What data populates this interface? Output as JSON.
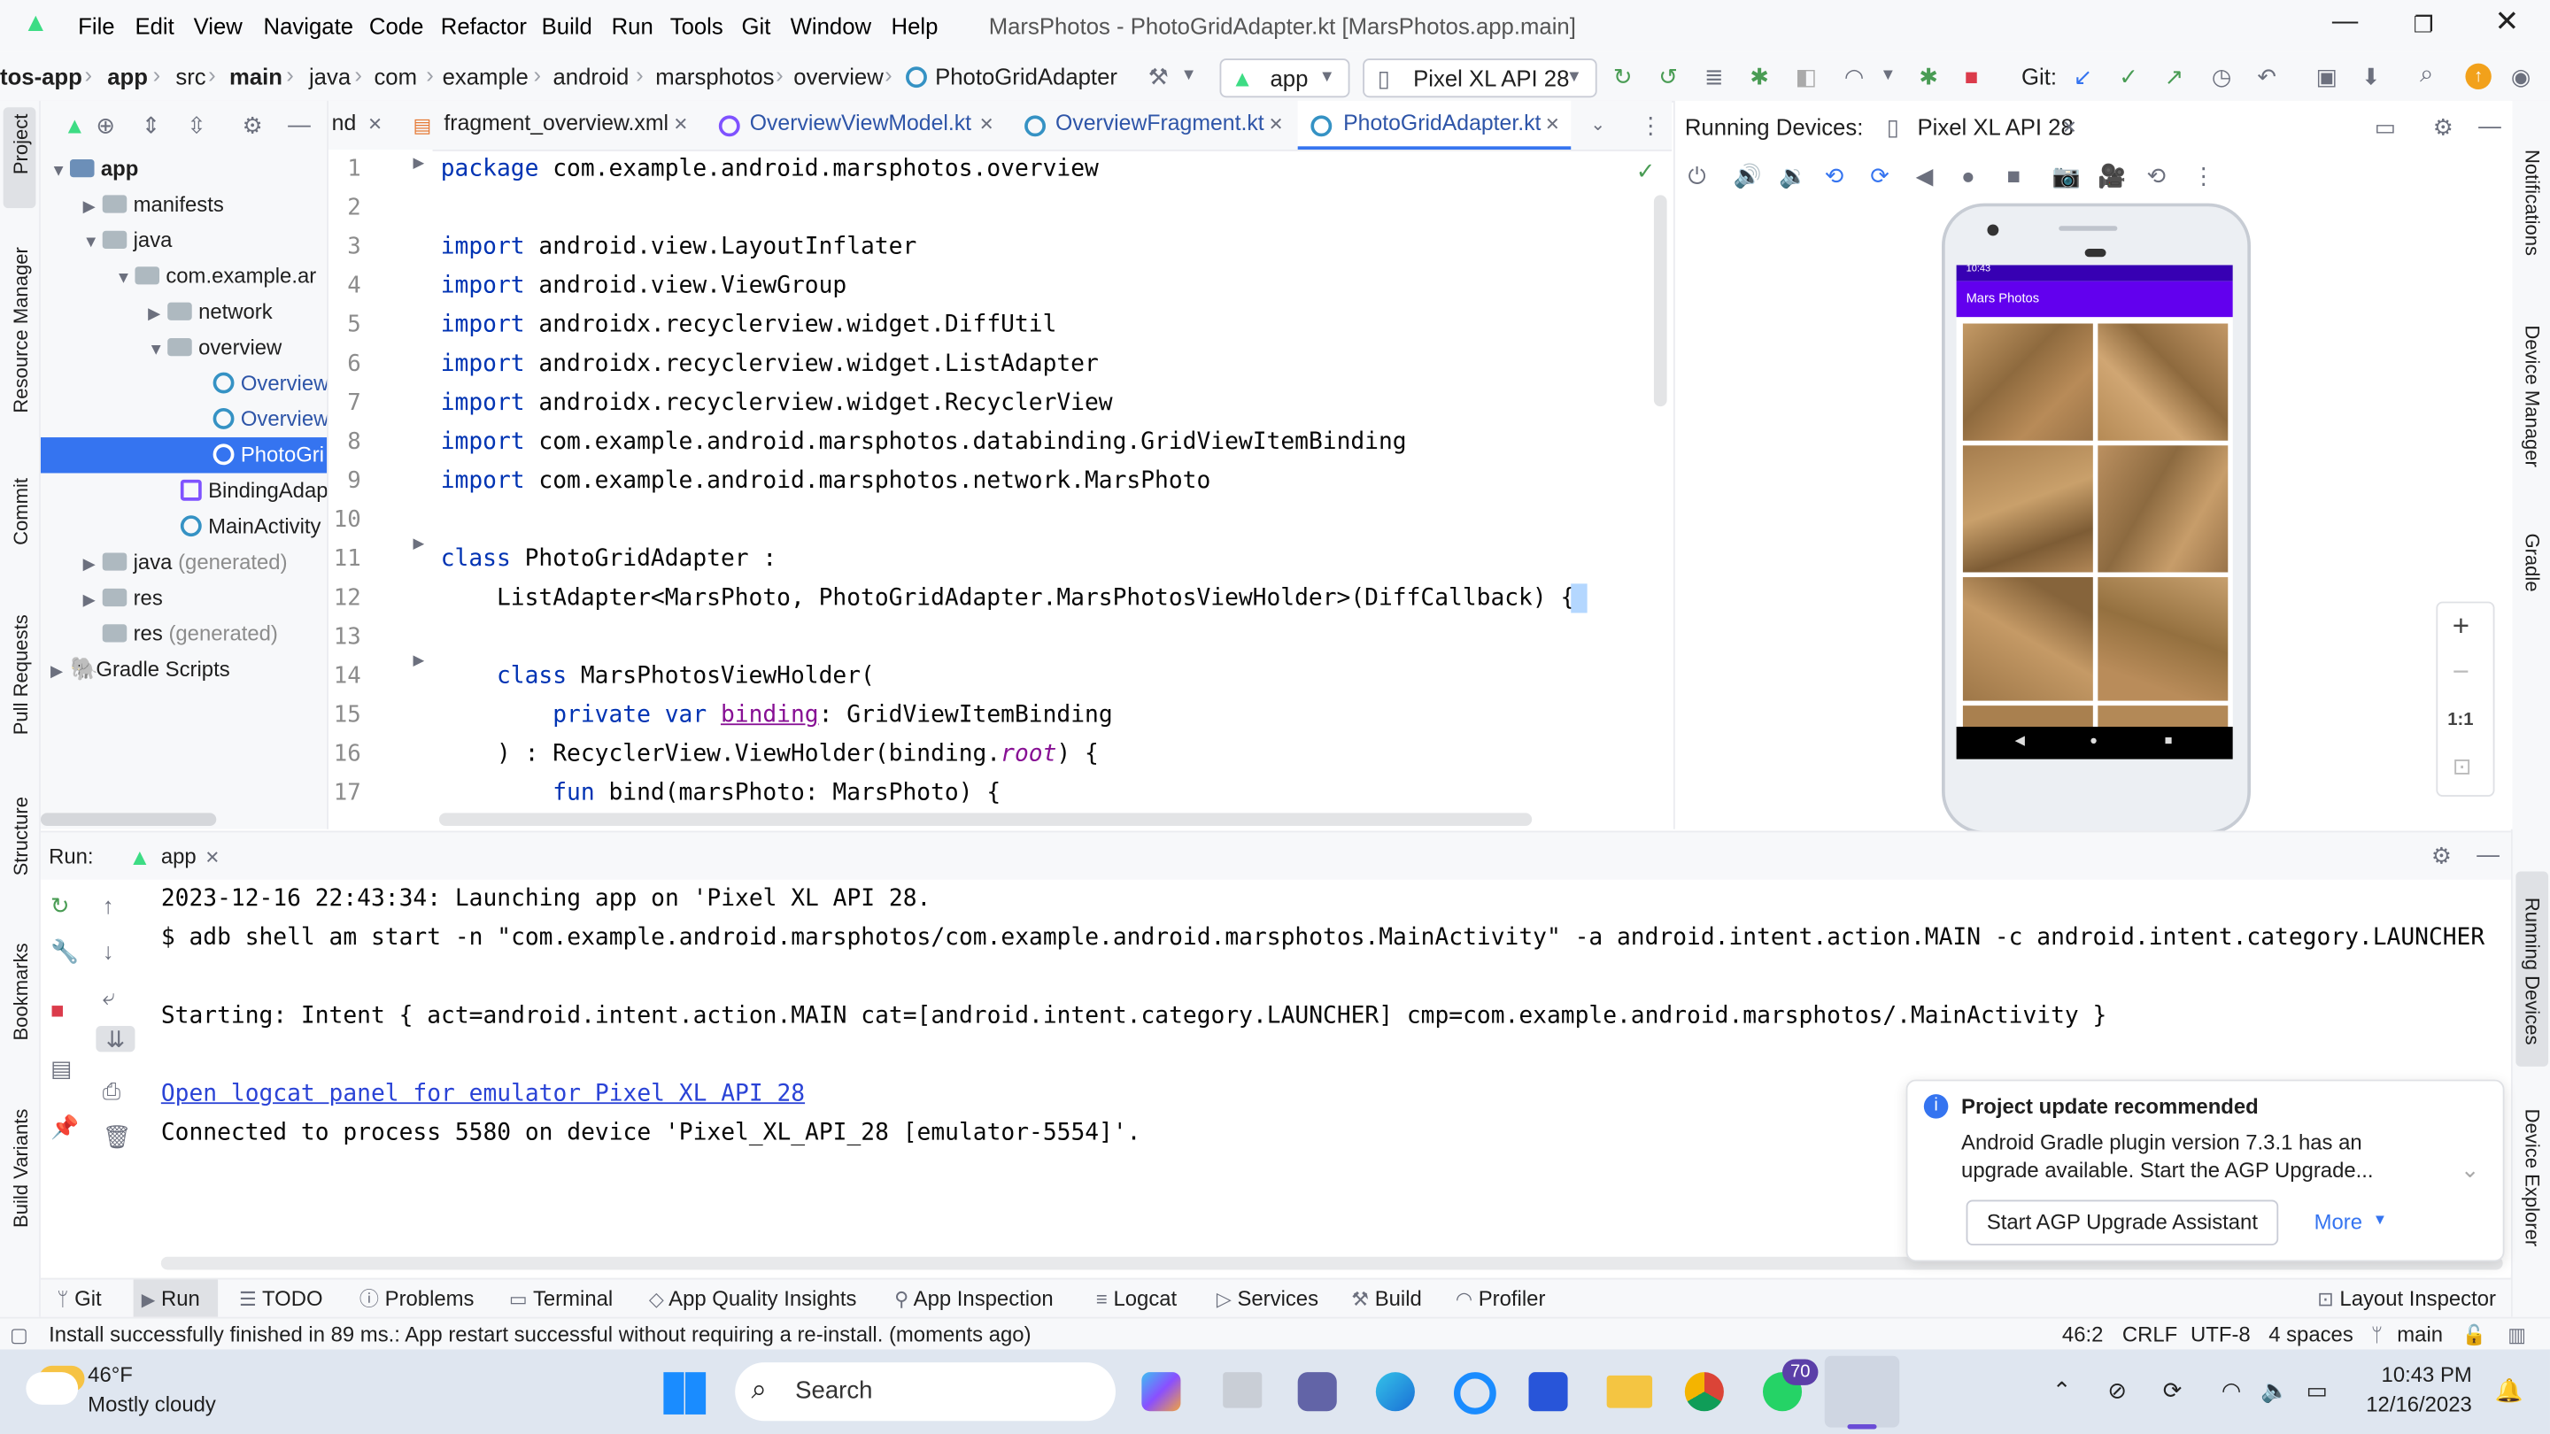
{
  "window": {
    "title": "MarsPhotos - PhotoGridAdapter.kt [MarsPhotos.app.main]"
  },
  "menu": [
    "File",
    "Edit",
    "View",
    "Navigate",
    "Code",
    "Refactor",
    "Build",
    "Run",
    "Tools",
    "Git",
    "Window",
    "Help"
  ],
  "breadcrumbs": [
    "tos-app",
    "app",
    "src",
    "main",
    "java",
    "com",
    "example",
    "android",
    "marsphotos",
    "overview",
    "PhotoGridAdapter"
  ],
  "toolbar": {
    "run_config": "app",
    "device": "Pixel XL API 28",
    "git_label": "Git:"
  },
  "project_tree": [
    {
      "label": "app",
      "bold": true
    },
    {
      "label": "manifests"
    },
    {
      "label": "java"
    },
    {
      "label": "com.example.ar"
    },
    {
      "label": "network"
    },
    {
      "label": "overview"
    },
    {
      "label": "Overview"
    },
    {
      "label": "Overview"
    },
    {
      "label": "PhotoGri"
    },
    {
      "label": "BindingAdap"
    },
    {
      "label": "MainActivity"
    },
    {
      "label": "java",
      "suffix": "(generated)"
    },
    {
      "label": "res"
    },
    {
      "label": "res",
      "suffix": "(generated)"
    },
    {
      "label": "Gradle Scripts"
    }
  ],
  "tabs": [
    "nd",
    "fragment_overview.xml",
    "OverviewViewModel.kt",
    "OverviewFragment.kt",
    "PhotoGridAdapter.kt"
  ],
  "code_lines": [
    "1",
    "2",
    "3",
    "4",
    "5",
    "6",
    "7",
    "8",
    "9",
    "10",
    "11",
    "12",
    "13",
    "14",
    "15",
    "16",
    "17"
  ],
  "code": {
    "l1a": "package",
    "l1b": " com.example.android.marsphotos.overview",
    "imp": "import",
    "l3": " android.view.LayoutInflater",
    "l4": " android.view.ViewGroup",
    "l5": " androidx.recyclerview.widget.DiffUtil",
    "l6": " androidx.recyclerview.widget.ListAdapter",
    "l7": " androidx.recyclerview.widget.RecyclerView",
    "l8": " com.example.android.marsphotos.databinding.GridViewItemBinding",
    "l9": " com.example.android.marsphotos.network.MarsPhoto",
    "l11a": "class",
    "l11b": " PhotoGridAdapter :",
    "l12": "    ListAdapter<MarsPhoto, PhotoGridAdapter.MarsPhotosViewHolder>(DiffCallback) {",
    "l14a": "    class",
    "l14b": " MarsPhotosViewHolder(",
    "l15a": "        private var",
    "l15b": "binding",
    "l15c": ": GridViewItemBinding",
    "l16a": "    ) : RecyclerView.ViewHolder(binding.",
    "l16b": "root",
    "l16c": ") {",
    "l17a": "        fun",
    "l17b": " bind(marsPhoto: MarsPhoto) {"
  },
  "devices": {
    "label": "Running Devices:",
    "tab": "Pixel XL API 28",
    "app_title": "Mars Photos",
    "phone_time": "10:43",
    "zoom_ratio": "1:1"
  },
  "run": {
    "label": "Run:",
    "config": "app"
  },
  "console": [
    "2023-12-16 22:43:34: Launching app on 'Pixel XL API 28.",
    "$ adb shell am start -n \"com.example.android.marsphotos/com.example.android.marsphotos.MainActivity\" -a android.intent.action.MAIN -c android.intent.category.LAUNCHER",
    "Starting: Intent { act=android.intent.action.MAIN cat=[android.intent.category.LAUNCHER] cmp=com.example.android.marsphotos/.MainActivity }",
    "Open logcat panel for emulator Pixel XL API 28",
    "Connected to process 5580 on device 'Pixel_XL_API_28 [emulator-5554]'."
  ],
  "notification": {
    "title": "Project update recommended",
    "body1": "Android Gradle plugin version 7.3.1 has an",
    "body2": "upgrade available. Start the AGP Upgrade...",
    "button": "Start AGP Upgrade Assistant",
    "more": "More"
  },
  "bottom_tabs": [
    "Git",
    "Run",
    "TODO",
    "Problems",
    "Terminal",
    "App Quality Insights",
    "App Inspection",
    "Logcat",
    "Services",
    "Build",
    "Profiler",
    "Layout Inspector"
  ],
  "left_stripe": [
    "Project",
    "Resource Manager",
    "Commit",
    "Pull Requests",
    "Structure",
    "Bookmarks",
    "Build Variants"
  ],
  "right_stripe": [
    "Notifications",
    "Device Manager",
    "Gradle",
    "Running Devices",
    "Device Explorer"
  ],
  "status": {
    "message": "Install successfully finished in 89 ms.: App restart successful without requiring a re-install. (moments ago)",
    "position": "46:2",
    "line_sep": "CRLF",
    "encoding": "UTF-8",
    "indent": "4 spaces",
    "branch": "main"
  },
  "taskbar": {
    "temp": "46°F",
    "weather": "Mostly cloudy",
    "search": "Search",
    "whatsapp_badge": "70",
    "time": "10:43 PM",
    "date": "12/16/2023"
  },
  "colors": {
    "accent": "#3574f0",
    "phone_appbar": "#6200ee",
    "mars": "#b08a5a"
  }
}
